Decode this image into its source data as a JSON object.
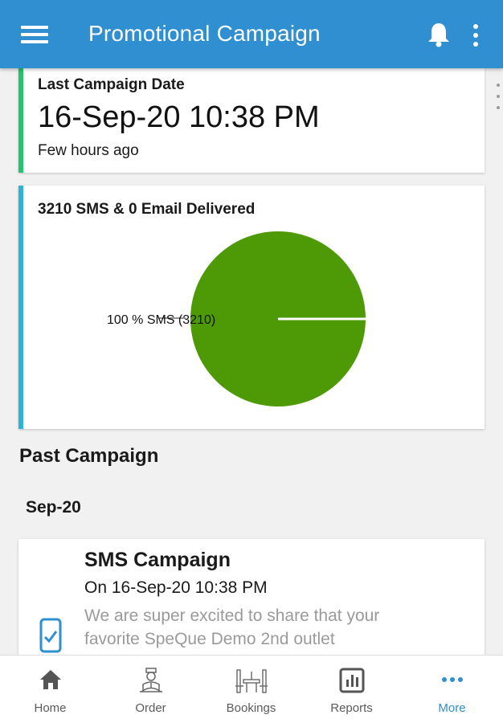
{
  "header": {
    "title": "Promotional Campaign",
    "menu_icon": "hamburger-menu-icon",
    "bell_icon": "bell-icon",
    "more_icon": "more-vertical-icon",
    "bar_color": "#2f8fd0"
  },
  "last_campaign": {
    "label": "Last Campaign Date",
    "date": "16-Sep-20 10:38 PM",
    "relative": "Few hours ago",
    "accent_color": "#25c36c"
  },
  "delivery": {
    "title": "3210 SMS & 0 Email Delivered",
    "accent_color": "#2cb4d6"
  },
  "chart_data": {
    "type": "pie",
    "title": "3210 SMS & 0 Email Delivered",
    "slices": [
      {
        "name": "SMS",
        "value": 3210,
        "percent": 100,
        "color": "#4e9a06"
      }
    ],
    "slice_label": "100 %  SMS (3210)"
  },
  "past": {
    "section_title": "Past Campaign",
    "month": "Sep-20",
    "campaigns": [
      {
        "title": "SMS Campaign",
        "date": "On 16-Sep-20 10:38 PM",
        "body": "We are super excited to share that your favorite SpeQue Demo 2nd outlet",
        "icon": "phone-check-icon"
      }
    ]
  },
  "bottom_nav": {
    "active": "More",
    "active_color": "#2f8fd0",
    "items": [
      {
        "label": "Home",
        "icon": "home-icon"
      },
      {
        "label": "Order",
        "icon": "waiter-icon"
      },
      {
        "label": "Bookings",
        "icon": "table-booking-icon"
      },
      {
        "label": "Reports",
        "icon": "reports-icon"
      },
      {
        "label": "More",
        "icon": "more-horizontal-icon"
      }
    ]
  }
}
